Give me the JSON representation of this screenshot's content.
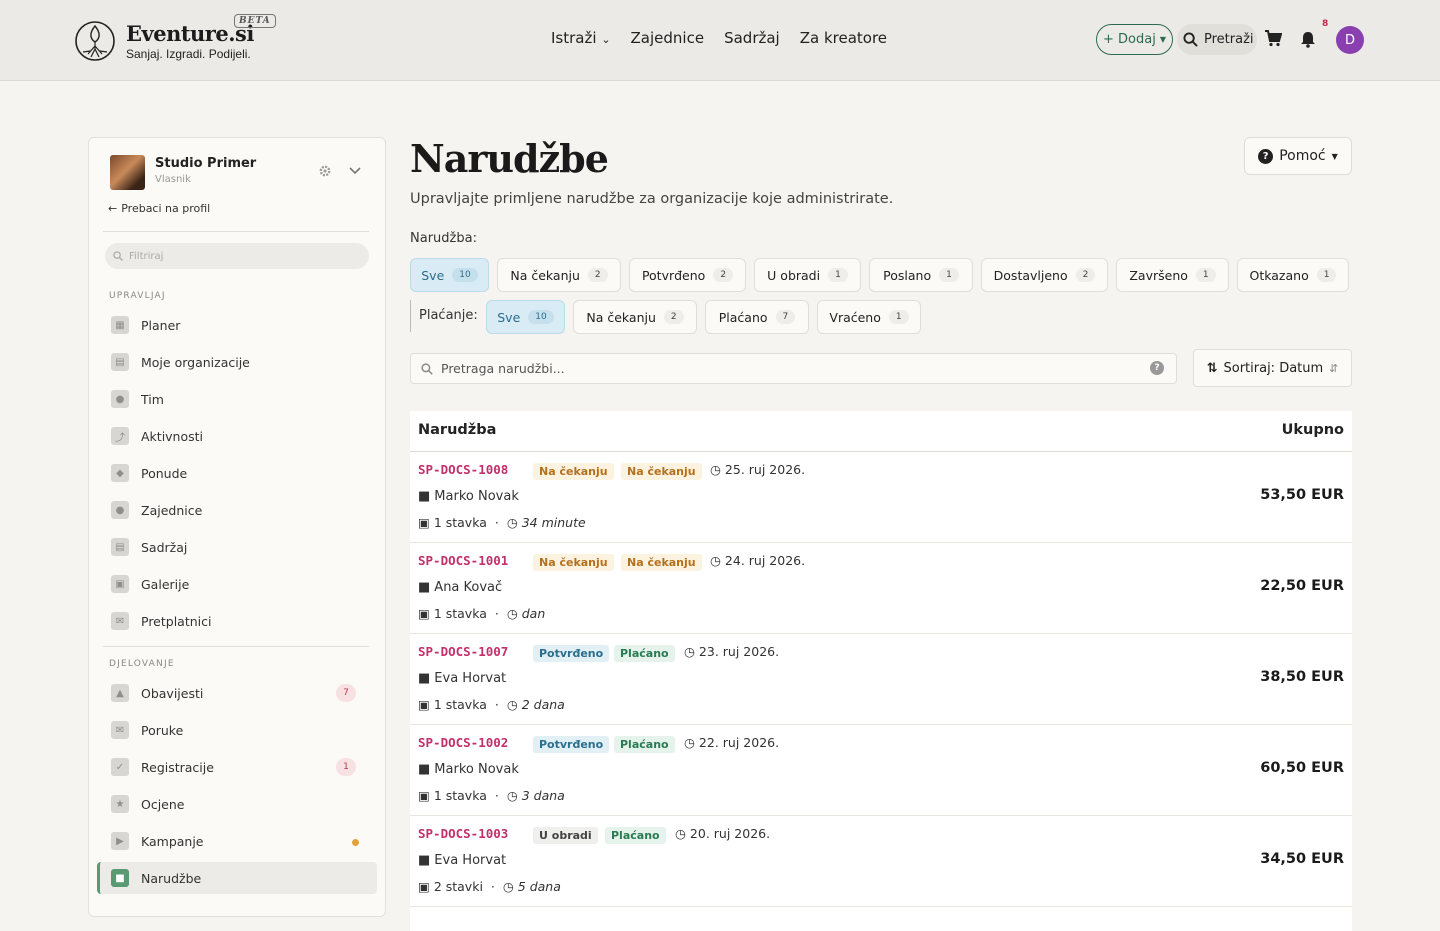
{
  "header": {
    "brand": "Eventure.si",
    "beta": "BETA",
    "tagline": "Sanjaj. Izgradi. Podijeli.",
    "nav": [
      "Istraži",
      "Zajednice",
      "Sadržaj",
      "Za kreatore"
    ],
    "add_label": "+ Dodaj",
    "search_label": "Pretraži",
    "notif_count": "8",
    "avatar_initial": "D"
  },
  "sidebar": {
    "org_name": "Studio Primer",
    "org_role": "Vlasnik",
    "switch_label": "Prebaci na profil",
    "filter_placeholder": "Filtriraj",
    "section_manage": "UPRAVLJAJ",
    "manage_items": [
      "Planer",
      "Moje organizacije",
      "Tim",
      "Aktivnosti",
      "Ponude",
      "Zajednice",
      "Sadržaj",
      "Galerije",
      "Pretplatnici"
    ],
    "section_ops": "DJELOVANJE",
    "ops_items": [
      "Obavijesti",
      "Poruke",
      "Registracije",
      "Ocjene",
      "Kampanje",
      "Narudžbe"
    ],
    "ops_counts": {
      "notifications": "7",
      "registrations": "1"
    },
    "active_item": "Narudžbe"
  },
  "main": {
    "title": "Narudžbe",
    "subtitle": "Upravljajte primljene narudžbe za organizacije koje administrirate.",
    "help_label": "Pomoć",
    "order_filter_label": "Narudžba:",
    "order_filters": [
      {
        "label": "Sve",
        "count": "10"
      },
      {
        "label": "Na čekanju",
        "count": "2"
      },
      {
        "label": "Potvrđeno",
        "count": "2"
      },
      {
        "label": "U obradi",
        "count": "1"
      },
      {
        "label": "Poslano",
        "count": "1"
      },
      {
        "label": "Dostavljeno",
        "count": "2"
      },
      {
        "label": "Završeno",
        "count": "1"
      },
      {
        "label": "Otkazano",
        "count": "1"
      }
    ],
    "payment_filter_label": "Plaćanje:",
    "payment_filters": [
      {
        "label": "Sve",
        "count": "10"
      },
      {
        "label": "Na čekanju",
        "count": "2"
      },
      {
        "label": "Plaćano",
        "count": "7"
      },
      {
        "label": "Vraćeno",
        "count": "1"
      }
    ],
    "search_placeholder": "Pretraga narudžbi...",
    "sort_label": "Sortiraj: Datum",
    "table": {
      "col_order": "Narudžba",
      "col_total": "Ukupno",
      "rows": [
        {
          "id": "SP-DOCS-1008",
          "status": "Na čekanju",
          "payment": "Na čekanju",
          "date": "25. ruj 2026.",
          "customer": "Marko Novak",
          "items": "1 stavka",
          "age": "34 minute",
          "total": "53,50 EUR"
        },
        {
          "id": "SP-DOCS-1001",
          "status": "Na čekanju",
          "payment": "Na čekanju",
          "date": "24. ruj 2026.",
          "customer": "Ana Kovač",
          "items": "1 stavka",
          "age": "dan",
          "total": "22,50 EUR"
        },
        {
          "id": "SP-DOCS-1007",
          "status": "Potvrđeno",
          "payment": "Plaćano",
          "date": "23. ruj 2026.",
          "customer": "Eva Horvat",
          "items": "1 stavka",
          "age": "2 dana",
          "total": "38,50 EUR"
        },
        {
          "id": "SP-DOCS-1002",
          "status": "Potvrđeno",
          "payment": "Plaćano",
          "date": "22. ruj 2026.",
          "customer": "Marko Novak",
          "items": "1 stavka",
          "age": "3 dana",
          "total": "60,50 EUR"
        },
        {
          "id": "SP-DOCS-1003",
          "status": "U obradi",
          "payment": "Plaćano",
          "date": "20. ruj 2026.",
          "customer": "Eva Horvat",
          "items": "2 stavki",
          "age": "5 dana",
          "total": "34,50 EUR"
        }
      ]
    }
  }
}
